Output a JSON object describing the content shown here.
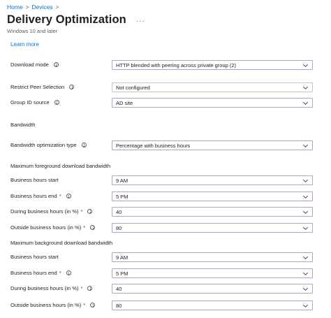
{
  "breadcrumb": {
    "home": "Home",
    "devices": "Devices",
    "sep": ">"
  },
  "header": {
    "title": "Delivery Optimization",
    "more": "···",
    "subtitle": "Windows 10 and later"
  },
  "learn_more": "Learn more",
  "fields": {
    "download_mode": {
      "label": "Download mode",
      "value": "HTTP blended with peering across private group (2)"
    },
    "restrict_peer": {
      "label": "Restrict Peer Selection",
      "value": "Not configured"
    },
    "group_id": {
      "label": "Group ID source",
      "value": "AD site"
    },
    "bw_type": {
      "label": "Bandwidth optimization type",
      "value": "Percentage with business hours"
    }
  },
  "sections": {
    "bandwidth": "Bandwidth",
    "foreground": "Maximum foreground download bandwidth",
    "background": "Maximum background download bandwidth"
  },
  "foreground": {
    "start": {
      "label": "Business hours start",
      "value": "9 AM"
    },
    "end": {
      "label": "Business hours end",
      "value": "5 PM"
    },
    "during": {
      "label": "During business hours (in %)",
      "value": "40"
    },
    "outside": {
      "label": "Outside business hours (in %)",
      "value": "80"
    }
  },
  "background": {
    "start": {
      "label": "Business hours start",
      "value": "9 AM"
    },
    "end": {
      "label": "Business hours end",
      "value": "5 PM"
    },
    "during": {
      "label": "During business hours (in %)",
      "value": "40"
    },
    "outside": {
      "label": "Outside business hours (in %)",
      "value": "80"
    }
  },
  "required_mark": "*"
}
